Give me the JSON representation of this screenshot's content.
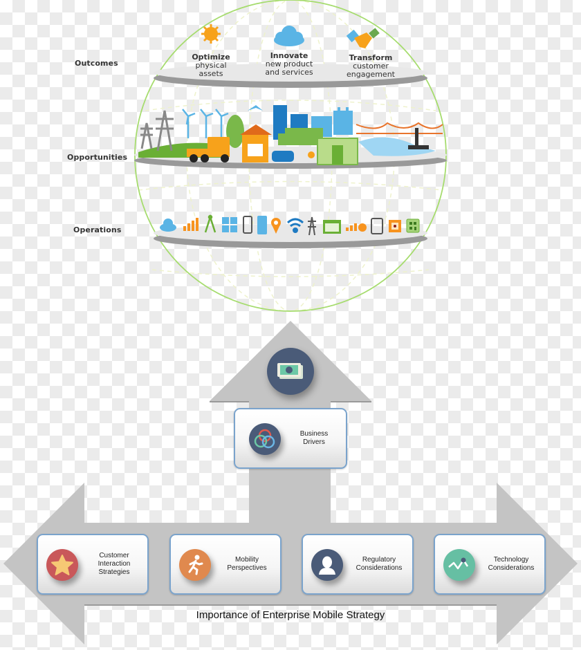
{
  "diagram": {
    "layers": [
      {
        "id": "outcomes",
        "label": "Outcomes"
      },
      {
        "id": "opportunities",
        "label": "Opportunities"
      },
      {
        "id": "operations",
        "label": "Operations"
      }
    ],
    "outcomes": [
      {
        "icon": "sun-icon",
        "title": "Optimize",
        "line1": "physical",
        "line2": "assets"
      },
      {
        "icon": "cloud-icon",
        "title": "Innovate",
        "line1": "new product",
        "line2": "and services"
      },
      {
        "icon": "handshake-icon",
        "title": "Transform",
        "line1": "customer",
        "line2": "engagement"
      }
    ],
    "opportunities_icons": [
      "power-pylon-icon",
      "wind-turbine-icon",
      "tree-icon",
      "truck-icon",
      "house-icon",
      "airplane-icon",
      "office-building-icon",
      "delivery-truck-icon",
      "car-icon",
      "runner-icon",
      "factory-icon",
      "warehouse-icon",
      "bridge-icon",
      "oil-rig-icon",
      "water-icon"
    ],
    "operations_icons": [
      "cloud-icon",
      "growth-chart-icon",
      "cell-tower-icon",
      "dashboard-tiles-icon",
      "smartphone-icon",
      "server-icon",
      "location-pin-icon",
      "wifi-icon",
      "transmission-tower-icon",
      "browser-window-icon",
      "analytics-icon",
      "tablet-icon",
      "chip-icon",
      "qr-code-icon"
    ],
    "top_icon": "money-icon",
    "business_drivers": {
      "label": "Business\nDrivers",
      "icon": "interlocking-rings-icon"
    },
    "cards": [
      {
        "label": "Customer\nInteraction\nStrategies",
        "icon": "star-icon",
        "color": "#c9585a"
      },
      {
        "label": "Mobility\nPerspectives",
        "icon": "running-person-icon",
        "color": "#e0894e"
      },
      {
        "label": "Regulatory\nConsiderations",
        "icon": "person-icon",
        "color": "#4a5b78"
      },
      {
        "label": "Technology\nConsiderations",
        "icon": "trend-line-icon",
        "color": "#66bfa3"
      }
    ],
    "caption": "Importance of Enterprise Mobile Strategy",
    "colors": {
      "arrow_gray": "#c4c4c4",
      "globe_green": "#a6dc6e",
      "badge_navy": "#4a5b78",
      "disc_top": "#e6e6e6",
      "disc_edge": "#9a9a9a"
    }
  }
}
